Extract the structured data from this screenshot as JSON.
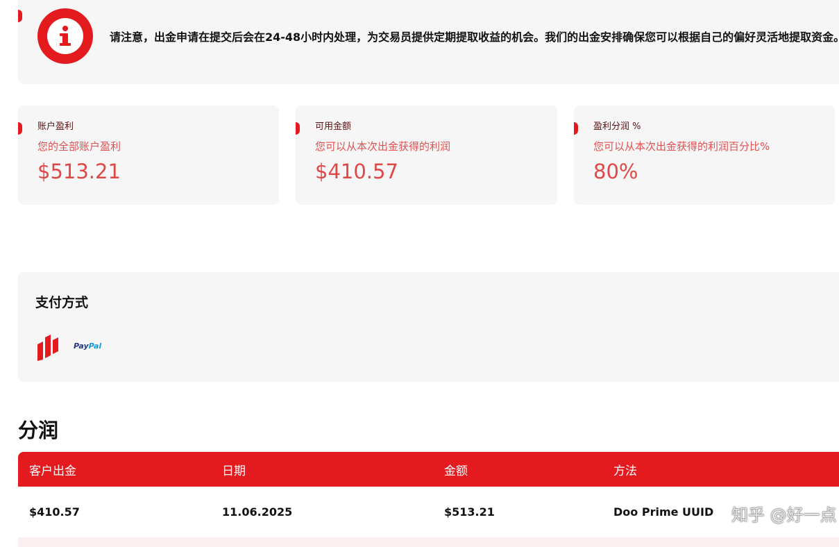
{
  "notice": {
    "text": "请注意，出金申请在提交后会在24-48小时内处理，为交易员提供定期提取收益的机会。我们的出金安排确保您可以根据自己的偏好灵活地提取资金。",
    "icon": "info-icon",
    "icon_color": "#e31b1e"
  },
  "cards": [
    {
      "title": "账户盈利",
      "subtitle": "您的全部账户盈利",
      "value": "$513.21"
    },
    {
      "title": "可用金额",
      "subtitle": "您可以从本次出金获得的利润",
      "value": "$410.57"
    },
    {
      "title": "盈利分润 %",
      "subtitle": "您可以从本次出金获得的利润百分比%",
      "value": "80%"
    }
  ],
  "payment": {
    "title": "支付方式",
    "methods": [
      {
        "icon": "doo-prime-logo-icon"
      },
      {
        "label_part1": "Pay",
        "label_part2": "Pal",
        "icon": "paypal-logo-icon"
      }
    ]
  },
  "profit_share": {
    "title": "分润",
    "columns": [
      "客户出金",
      "日期",
      "金额",
      "方法"
    ],
    "rows": [
      [
        "$410.57",
        "11.06.2025",
        "$513.21",
        "Doo Prime UUID"
      ]
    ]
  },
  "watermark": "知乎 @好一点",
  "colors": {
    "accent": "#e31b1e",
    "card_bg": "#f6f6f6",
    "value_text": "#e04848"
  }
}
